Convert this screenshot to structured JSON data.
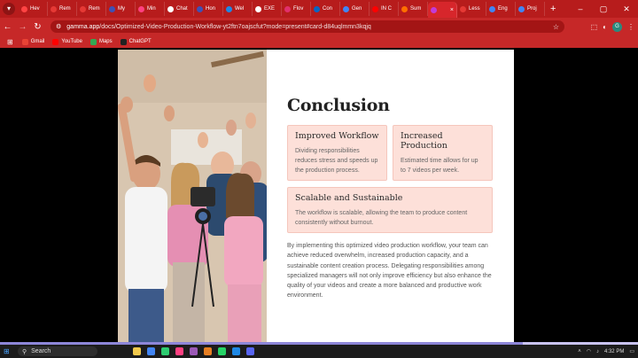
{
  "browser": {
    "tabs": [
      {
        "label": "Hev",
        "color": "#ff4444"
      },
      {
        "label": "Rem",
        "color": "#e53935"
      },
      {
        "label": "Rem",
        "color": "#e53935"
      },
      {
        "label": "My",
        "color": "#3f51b5"
      },
      {
        "label": "Min",
        "color": "#ff4081"
      },
      {
        "label": "Chat",
        "color": "#ffffff"
      },
      {
        "label": "Hon",
        "color": "#3f51b5"
      },
      {
        "label": "Wel",
        "color": "#1e88e5"
      },
      {
        "label": "EXE",
        "color": "#ffffff"
      },
      {
        "label": "Flov",
        "color": "#e1306c"
      },
      {
        "label": "Con",
        "color": "#0a66c2"
      },
      {
        "label": "Gen",
        "color": "#4285f4"
      },
      {
        "label": "IN C",
        "color": "#ff0000"
      },
      {
        "label": "Sum",
        "color": "#ff6f00"
      },
      {
        "label": "",
        "color": "#c23bd8",
        "active": true
      },
      {
        "label": "Less",
        "color": "#e53935"
      },
      {
        "label": "Eng",
        "color": "#4285f4"
      },
      {
        "label": "Proj",
        "color": "#4285f4"
      }
    ],
    "new_tab": "+",
    "close_tab": "×",
    "window_controls": {
      "minimize": "–",
      "maximize": "▢",
      "close": "✕"
    },
    "url_host": "gamma.app",
    "url_path": "/docs/Optimized-Video-Production-Workflow-yt2ftn7oajscfut?mode=present#card-d84uqlmmn3kqjq",
    "profile_initial": "G",
    "bookmarks": [
      {
        "label": "Gmail",
        "color": "#ea4335"
      },
      {
        "label": "YouTube",
        "color": "#ff0000"
      },
      {
        "label": "Maps",
        "color": "#34a853"
      },
      {
        "label": "ChatGPT",
        "color": "#222222"
      }
    ]
  },
  "slide": {
    "title": "Conclusion",
    "cards": [
      {
        "heading": "Improved Workflow",
        "body": "Dividing responsibilities reduces stress and speeds up the production process."
      },
      {
        "heading": "Increased Production",
        "body": "Estimated time allows for up to 7 videos per week."
      },
      {
        "heading": "Scalable and Sustainable",
        "body": "The workflow is scalable, allowing the team to produce content consistently without burnout."
      }
    ],
    "paragraph": "By implementing this optimized video production workflow, your team can achieve reduced overwhelm, increased production capacity, and a sustainable content creation process. Delegating responsibilities among specialized managers will not only improve efficiency but also enhance the quality of your videos and create a more balanced and productive work environment."
  },
  "presentation_progress": 0.82,
  "taskbar": {
    "search_placeholder": "Search",
    "time": "4:32 PM",
    "app_colors": [
      "#f2c94c",
      "#4285f4",
      "#2ecc71",
      "#ff4081",
      "#9b59b6",
      "#e67e22",
      "#25d366",
      "#1e88e5",
      "#5865f2"
    ]
  }
}
